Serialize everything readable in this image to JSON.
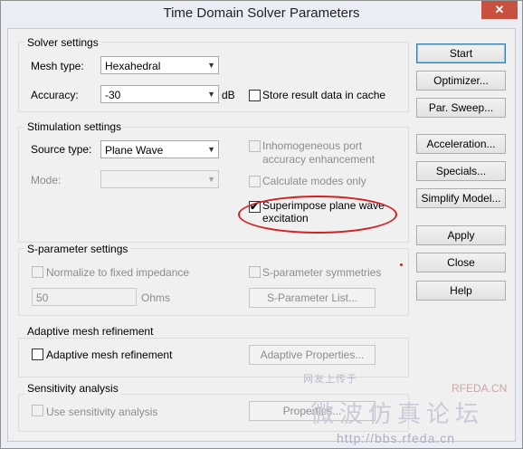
{
  "window": {
    "title": "Time Domain Solver Parameters",
    "close_glyph": "✕"
  },
  "solver_settings": {
    "group_label": "Solver settings",
    "mesh_type_label": "Mesh type:",
    "mesh_type_value": "Hexahedral",
    "accuracy_label": "Accuracy:",
    "accuracy_value": "-30",
    "accuracy_unit": "dB",
    "store_cache_label": "Store result data in cache",
    "store_cache_checked": false
  },
  "stimulation_settings": {
    "group_label": "Stimulation settings",
    "source_type_label": "Source type:",
    "source_type_value": "Plane Wave",
    "mode_label": "Mode:",
    "mode_value": "",
    "inhomogeneous_label_1": "Inhomogeneous port",
    "inhomogeneous_label_2": "accuracy enhancement",
    "calc_modes_label": "Calculate modes only",
    "superimpose_label_1": "Superimpose plane wave",
    "superimpose_label_2": "excitation",
    "superimpose_checked": true
  },
  "sparameter_settings": {
    "group_label": "S-parameter settings",
    "normalize_label": "Normalize to fixed impedance",
    "impedance_value": "50",
    "impedance_unit": "Ohms",
    "symmetries_label": "S-parameter symmetries",
    "list_button": "S-Parameter List..."
  },
  "adaptive_mesh": {
    "group_label": "Adaptive mesh refinement",
    "checkbox_label": "Adaptive mesh refinement",
    "properties_button": "Adaptive Properties..."
  },
  "sensitivity": {
    "group_label": "Sensitivity analysis",
    "checkbox_label": "Use sensitivity analysis",
    "properties_button": "Properties..."
  },
  "buttons": {
    "start": "Start",
    "optimizer": "Optimizer...",
    "par_sweep": "Par. Sweep...",
    "acceleration": "Acceleration...",
    "specials": "Specials...",
    "simplify_model": "Simplify Model...",
    "apply": "Apply",
    "close": "Close",
    "help": "Help"
  },
  "watermark": {
    "line1": "网友上传于",
    "brand": "RFEDA.CN",
    "big": "微波仿真论坛",
    "url": "http://bbs.rfeda.cn"
  },
  "colors": {
    "annotation_red": "#d42020",
    "default_button_border": "#3c7fb1",
    "close_button": "#c7503e"
  },
  "icons": {
    "dropdown": "chevron-down-icon",
    "check": "checkmark-icon"
  }
}
